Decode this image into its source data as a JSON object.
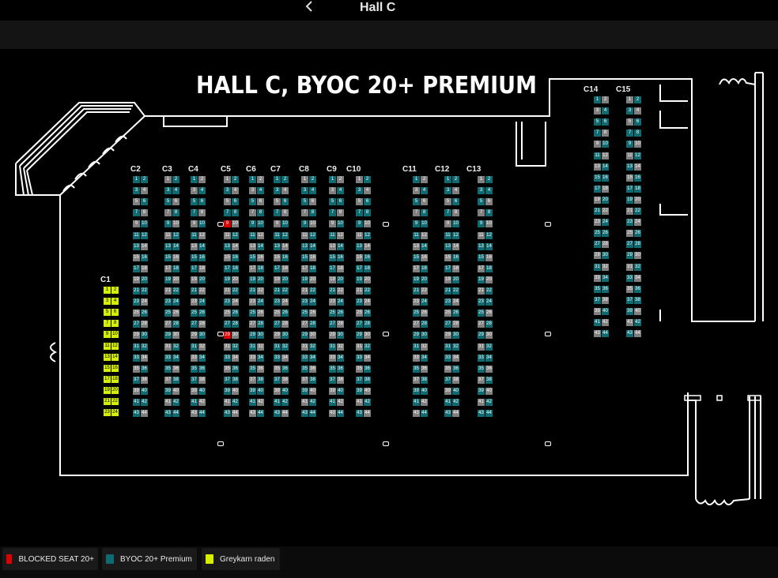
{
  "header": {
    "title": "Hall C",
    "back_icon": "chevron-left-icon"
  },
  "map": {
    "title": "HALL C, BYOC 20+ PREMIUM"
  },
  "colors": {
    "premium": "#0f6b72",
    "available": "#808080",
    "blocked": "#e00000",
    "greykarn": "#d4ef00"
  },
  "sections": [
    {
      "name": "C1",
      "type": "greykarn",
      "rows": 12,
      "blocked": []
    },
    {
      "name": "C2",
      "type": "mix",
      "rows": 22,
      "blocked": []
    },
    {
      "name": "C3",
      "type": "mix",
      "rows": 22,
      "blocked": []
    },
    {
      "name": "C4",
      "type": "mix",
      "rows": 22,
      "blocked": []
    },
    {
      "name": "C5",
      "type": "mix",
      "rows": 22,
      "blocked": [
        9,
        29
      ]
    },
    {
      "name": "C6",
      "type": "mix",
      "rows": 22,
      "blocked": []
    },
    {
      "name": "C7",
      "type": "mix",
      "rows": 22,
      "blocked": []
    },
    {
      "name": "C8",
      "type": "mix",
      "rows": 22,
      "blocked": []
    },
    {
      "name": "C9",
      "type": "mix",
      "rows": 22,
      "blocked": []
    },
    {
      "name": "C10",
      "type": "mix",
      "rows": 22,
      "blocked": []
    },
    {
      "name": "C11",
      "type": "mix",
      "rows": 22,
      "blocked": []
    },
    {
      "name": "C12",
      "type": "mix",
      "rows": 22,
      "blocked": []
    },
    {
      "name": "C13",
      "type": "mix",
      "rows": 22,
      "blocked": []
    },
    {
      "name": "C14",
      "type": "mix",
      "rows": 22,
      "blocked": []
    },
    {
      "name": "C15",
      "type": "mix",
      "rows": 22,
      "blocked": []
    }
  ],
  "legend": [
    {
      "label": "BLOCKED SEAT 20+",
      "color": "#e00000"
    },
    {
      "label": "BYOC 20+ Premium",
      "color": "#0f6b72"
    },
    {
      "label": "Greykarn raden",
      "color": "#d4ef00"
    }
  ]
}
